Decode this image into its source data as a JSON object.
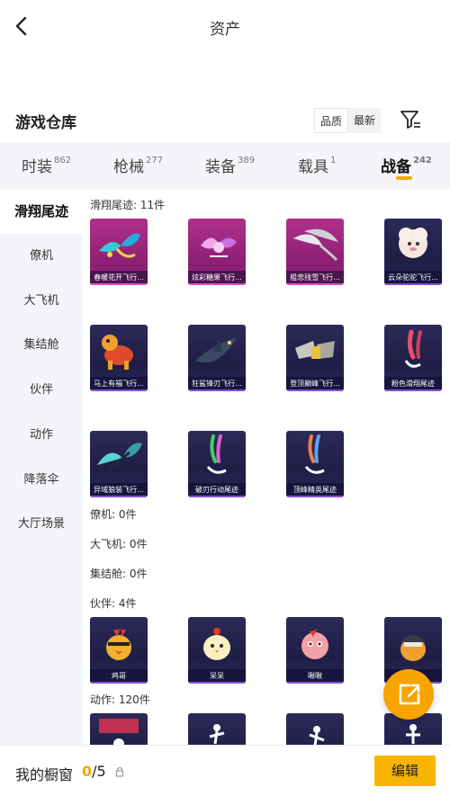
{
  "header": {
    "title": "资产"
  },
  "warehouse": {
    "title": "游戏仓库",
    "sort_options": [
      "品质",
      "最新"
    ],
    "active_sort": "品质"
  },
  "tabs": [
    {
      "label": "时装",
      "count": "862"
    },
    {
      "label": "枪械",
      "count": "277"
    },
    {
      "label": "装备",
      "count": "389"
    },
    {
      "label": "载具",
      "count": "1"
    },
    {
      "label": "战备",
      "count": "242",
      "active": true
    }
  ],
  "sidebar": {
    "items": [
      "滑翔尾迹",
      "僚机",
      "大飞机",
      "集结舱",
      "伙伴",
      "动作",
      "降落伞",
      "大厅场景"
    ],
    "active": "滑翔尾迹"
  },
  "sections": {
    "glide_trail": {
      "title": "滑翔尾迹: 11件",
      "items": [
        "春暖花开飞行...",
        "炫彩糖果飞行...",
        "粗悲残雪飞行...",
        "云朵驼驼飞行...",
        "马上有福飞行...",
        "狂鲨锋刃飞行...",
        "登顶巅峰飞行...",
        "粉色滑翔尾迹",
        "异域狼装飞行...",
        "破刃行动尾迹",
        "顶峰精英尾迹"
      ]
    },
    "wingman": {
      "title": "僚机: 0件"
    },
    "big_plane": {
      "title": "大飞机: 0件"
    },
    "assembly_pod": {
      "title": "集结舱: 0件"
    },
    "partner": {
      "title": "伙伴: 4件",
      "items": [
        "鸡哥",
        "呆呆",
        "啾啾",
        ""
      ]
    },
    "action": {
      "title": "动作: 120件"
    }
  },
  "bottom": {
    "label": "我的橱窗",
    "current": "0",
    "total": "/5",
    "edit_label": "编辑"
  },
  "colors": {
    "accent": "#f7b500",
    "rare_frame": "#8a4fd0",
    "epic_frame": "#e050c8"
  }
}
